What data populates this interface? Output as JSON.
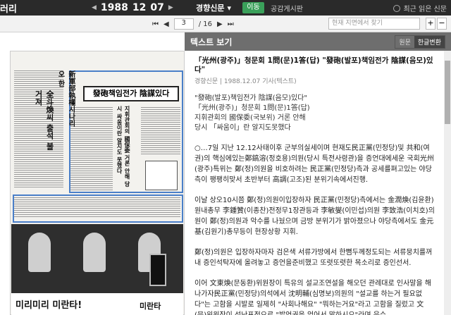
{
  "app": {
    "logo": "러리"
  },
  "date": {
    "year": "1988",
    "month": "12",
    "day": "07",
    "prev": "◀",
    "next": "▶"
  },
  "source": {
    "selected": "경향신문",
    "dropdown": "▾",
    "go_label": "이동",
    "public_label": "공감게시판"
  },
  "recent": {
    "label": "최근 읽은 신문"
  },
  "pager": {
    "first": "⏮",
    "prev": "◀",
    "current": "3",
    "total": "/ 16",
    "next": "▶",
    "last": "⏭"
  },
  "search": {
    "placeholder": "현재 지면에서 찾기"
  },
  "zoom": {
    "in": "+",
    "out": "−"
  },
  "scan": {
    "headline": "發砲책임전가 陰謀있다",
    "side_head": "新軍部執權시나리오 한",
    "sub_head": "全斗煥씨 출석 불거져",
    "mid_col": "지휘관회의 國保委 거론 안해 당시 싸움이란 알지도 못했다",
    "ad_slogan": "미리미리 미란타!",
    "ad_brand": "미란타"
  },
  "panel": {
    "title": "텍스트 보기",
    "toggle_original": "원문",
    "toggle_korean": "한글변환",
    "article": {
      "title": "「光州(광주)」청문회 1問(문)1答(답) \"發砲(발포)책임전가 陰謀(음모)있다\"",
      "meta": "경향신문 | 1988.12.07 기사(텍스트)",
      "subs": [
        "\"發砲(발포)책임전가 陰謀(음모)있다\"",
        "「光州(광주)」청문회 1問(문)1答(답)",
        "지휘관회의 國保委(국보위) 거론 안해",
        "당시 「싸움이」란 알지도못했다"
      ],
      "paragraphs": [
        "○…7일 지난 12.12사태이후 군부의실세이며 현재도民正黨(민정당)및 共和(여권)의 핵심에있는鄭鎬溶(정호용)의원(당시 특전사령관)을 증언대에세운 국회光州(광주)특위는 鄭(정)의원을 비호하려는 民正黨(민정당)측과 공세를펴고있는 야당측이 팽팽히맞서 초반부터 高調(고조)된 분위기속에서진행.",
        "이날 상오10시쯤 鄭(정)의원이입장하자 民正黨(민정당)측에서는 金潤煥(김윤환)원내총무 李鍾贊(이종찬)전정무1장관등과 李敏燮(이민섭)의원 李致浩(이치호)의원이 鄭(정)의원과 악수를 나눴으며 금방 분위기가 밝아졌으나 야당측에서도 金元基(김원기)총무등이 현장상황 지휘.",
        "鄭(정)의원은 입장하자마자 검은색 서류가방에서 한뼘두께정도되는 서류뭉치를꺼내 증인석탁자에 올려놓고 증언을준비했고 또렷또렷한 목소리로 증인선서.",
        "이어 文東煥(문동환)위원장이 특유의 설교조연설을 해오던 관례대로 인사말을 해나가자民正黨(민정당)의석에서 沈明輔(심명보)의원의 \"설교를 하는거 필요없다\"는 고함을 시발로 일제히 \"사회나해요\" \"뭐하는거요\"라고 고함을 질렀고 文(문)위원장이 성난표정으로 \"발언권을 얻어서 말하시오\"라며 응수."
      ]
    }
  }
}
